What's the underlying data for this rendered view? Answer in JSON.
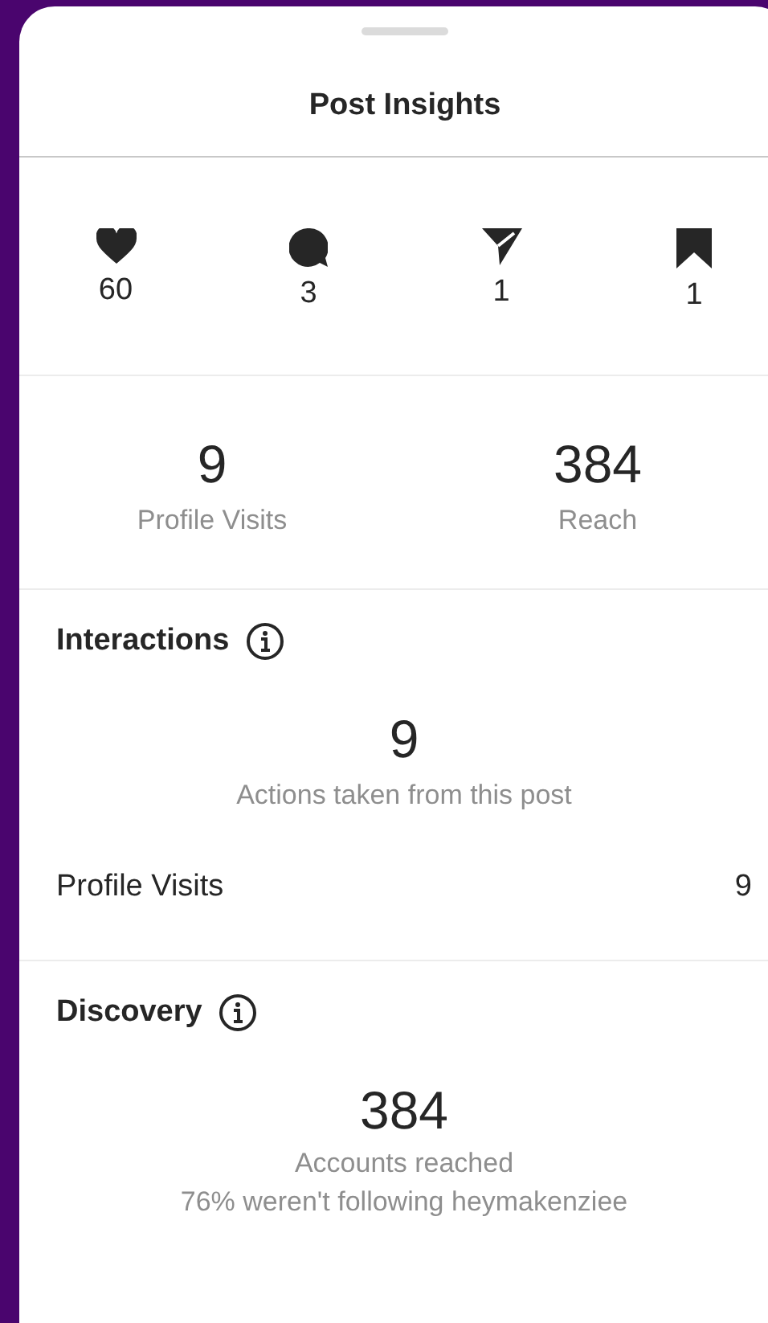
{
  "title": "Post Insights",
  "engagement": [
    {
      "kind": "likes",
      "count": "60"
    },
    {
      "kind": "comments",
      "count": "3"
    },
    {
      "kind": "shares",
      "count": "1"
    },
    {
      "kind": "saves",
      "count": "1"
    }
  ],
  "overview": [
    {
      "value": "9",
      "label": "Profile Visits"
    },
    {
      "value": "384",
      "label": "Reach"
    }
  ],
  "interactions": {
    "heading": "Interactions",
    "total": "9",
    "caption": "Actions taken from this post",
    "rows": [
      {
        "label": "Profile Visits",
        "value": "9"
      }
    ]
  },
  "discovery": {
    "heading": "Discovery",
    "total": "384",
    "caption": "Accounts reached",
    "note": "76% weren't following heymakenziee"
  }
}
